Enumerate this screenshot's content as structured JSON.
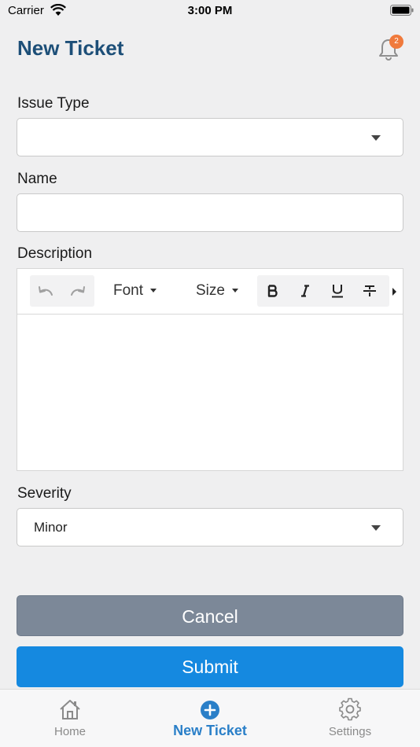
{
  "status_bar": {
    "carrier": "Carrier",
    "time": "3:00 PM"
  },
  "header": {
    "title": "New Ticket",
    "notification_count": "2"
  },
  "form": {
    "issue_type": {
      "label": "Issue Type",
      "value": ""
    },
    "name": {
      "label": "Name",
      "value": ""
    },
    "description": {
      "label": "Description",
      "toolbar": {
        "font_label": "Font",
        "size_label": "Size"
      },
      "value": ""
    },
    "severity": {
      "label": "Severity",
      "value": "Minor"
    }
  },
  "actions": {
    "cancel_label": "Cancel",
    "submit_label": "Submit"
  },
  "tab_bar": {
    "items": [
      {
        "label": "Home",
        "icon": "home-icon",
        "active": false
      },
      {
        "label": "New Ticket",
        "icon": "plus-circle-icon",
        "active": true
      },
      {
        "label": "Settings",
        "icon": "gear-icon",
        "active": false
      }
    ],
    "active_color": "#2a7fc8",
    "inactive_color": "#8a8a8a"
  },
  "colors": {
    "title": "#1d4f78",
    "submit": "#1589e0",
    "cancel": "#7c8898",
    "badge": "#f07a3c"
  }
}
